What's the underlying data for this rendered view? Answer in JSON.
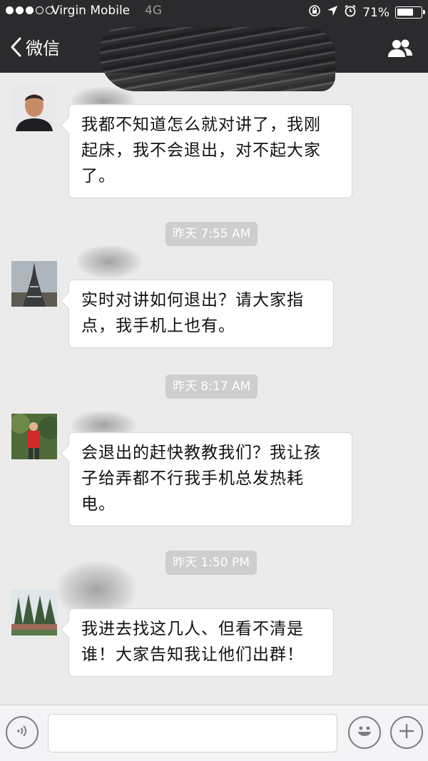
{
  "status": {
    "carrier": "Virgin Mobile",
    "network": "4G",
    "battery_text": "71%",
    "battery_level": 0.71
  },
  "nav": {
    "back_label": "微信"
  },
  "messages": [
    {
      "lines": [
        "我都不知道怎么就对讲了，我刚",
        "起床，我不会退出，对不起大家",
        "了。"
      ]
    },
    {
      "time": "昨天 7:55 AM",
      "lines": [
        "实时对讲如何退出？请大家指",
        "点，我手机上也有。"
      ]
    },
    {
      "time": "昨天 8:17 AM",
      "lines": [
        "会退出的赶快教教我们？我让孩",
        "子给弄都不行我手机总发热耗",
        "电。"
      ]
    },
    {
      "time": "昨天 1:50 PM",
      "lines": [
        "我进去找这几人、但看不清是",
        "谁！大家告知我让他们出群！"
      ]
    }
  ],
  "icons": {
    "back": "chevron-left-icon",
    "group": "group-people-icon",
    "voice": "voice-icon",
    "emoji": "emoji-icon",
    "plus": "plus-icon"
  },
  "colors": {
    "header_bg": "#2b2b2e",
    "chat_bg": "#ebebeb",
    "bubble_bg": "#ffffff",
    "timestamp_bg": "#cecece"
  }
}
